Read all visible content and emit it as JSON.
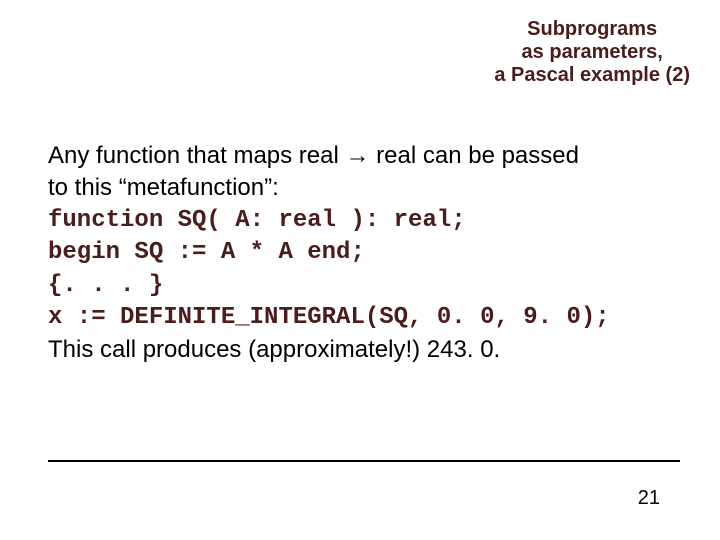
{
  "title": {
    "line1": "Subprograms",
    "line2": "as parameters,",
    "line3": "a Pascal example (2)"
  },
  "body": {
    "intro_pre": "Any function that maps real ",
    "arrow": "→",
    "intro_post": " real can be passed",
    "intro_line2": "to this “metafunction”:",
    "code_line1": "function SQ( A: real ): real;",
    "code_line2": "begin SQ := A * A end;",
    "code_line3": "{. . . }",
    "code_line4": "x := DEFINITE_INTEGRAL(SQ, 0. 0, 9. 0);",
    "outro": "This call produces (approximately!) 243. 0."
  },
  "page_number": "21"
}
